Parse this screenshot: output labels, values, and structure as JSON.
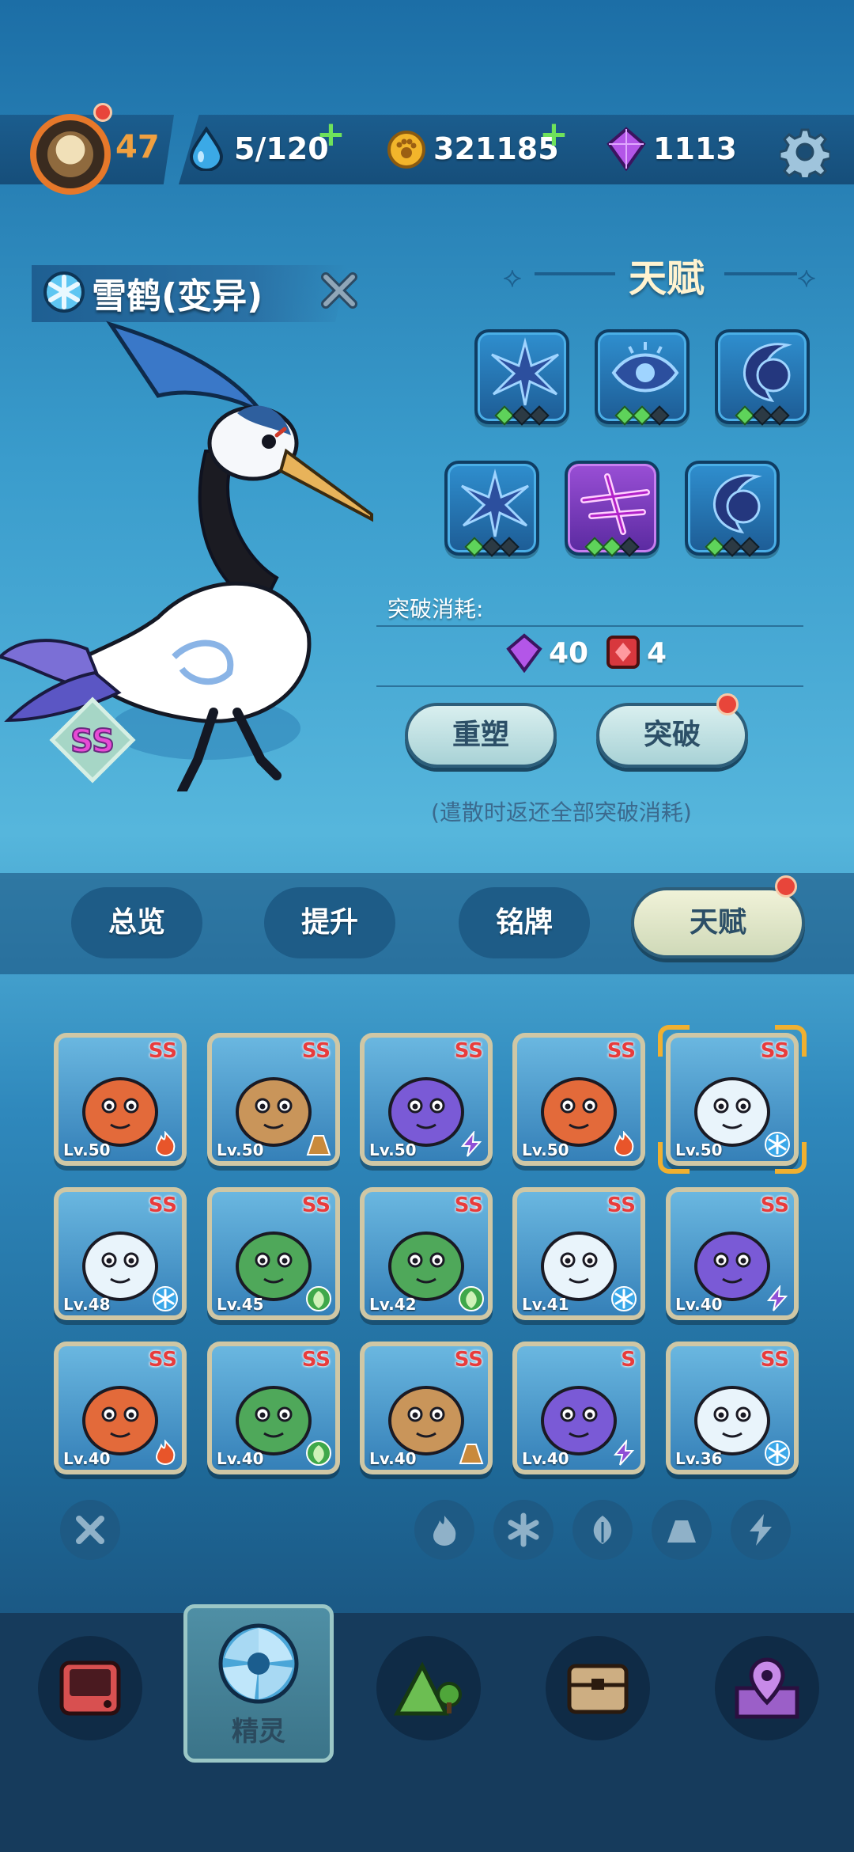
{
  "player": {
    "level": "47"
  },
  "resources": {
    "stamina": "5/120",
    "coins": "321185",
    "gems": "1113"
  },
  "pet": {
    "name": "雪鹤(变异)",
    "rank": "SS",
    "element": "ice"
  },
  "talent": {
    "title": "天赋",
    "slots": [
      {
        "icon": "ice-star-icon",
        "gems_lit": 1,
        "color": "blue"
      },
      {
        "icon": "eye-icon",
        "gems_lit": 2,
        "color": "blue"
      },
      {
        "icon": "crescent-icon",
        "gems_lit": 1,
        "color": "blue"
      },
      {
        "icon": "ice-star-icon",
        "gems_lit": 1,
        "color": "blue"
      },
      {
        "icon": "slash-star-icon",
        "gems_lit": 2,
        "color": "purple"
      },
      {
        "icon": "crescent-icon",
        "gems_lit": 1,
        "color": "blue"
      }
    ],
    "breakthrough_cost_label": "突破消耗:",
    "cost_gems": "40",
    "cost_items": "4",
    "reshape_label": "重塑",
    "breakthrough_label": "突破",
    "note": "(遣散时返还全部突破消耗)"
  },
  "tabs": [
    {
      "label": "总览"
    },
    {
      "label": "提升"
    },
    {
      "label": "铭牌"
    },
    {
      "label": "天赋",
      "active": true
    }
  ],
  "pets": [
    {
      "name": "fire-sprite",
      "rank": "SS",
      "level": "Lv.50",
      "element": "fire"
    },
    {
      "name": "mandrake",
      "rank": "SS",
      "level": "Lv.50",
      "element": "earth"
    },
    {
      "name": "purple-dragon",
      "rank": "SS",
      "level": "Lv.50",
      "element": "thunder"
    },
    {
      "name": "red-horn",
      "rank": "SS",
      "level": "Lv.50",
      "element": "fire"
    },
    {
      "name": "snow-crane",
      "rank": "SS",
      "level": "Lv.50",
      "element": "ice",
      "selected": true
    },
    {
      "name": "ice-fox",
      "rank": "SS",
      "level": "Lv.48",
      "element": "ice"
    },
    {
      "name": "green-serpent",
      "rank": "SS",
      "level": "Lv.45",
      "element": "grass"
    },
    {
      "name": "hooded-shade",
      "rank": "SS",
      "level": "Lv.42",
      "element": "grass"
    },
    {
      "name": "blue-dragon",
      "rank": "SS",
      "level": "Lv.41",
      "element": "ice"
    },
    {
      "name": "purple-pig",
      "rank": "SS",
      "level": "Lv.40",
      "element": "thunder"
    },
    {
      "name": "red-dragon",
      "rank": "SS",
      "level": "Lv.40",
      "element": "fire"
    },
    {
      "name": "leaf-monkey",
      "rank": "SS",
      "level": "Lv.40",
      "element": "grass"
    },
    {
      "name": "shiba",
      "rank": "SS",
      "level": "Lv.40",
      "element": "earth"
    },
    {
      "name": "purple-dragon-2",
      "rank": "S",
      "level": "Lv.40",
      "element": "thunder"
    },
    {
      "name": "snow-crane-2",
      "rank": "SS",
      "level": "Lv.36",
      "element": "ice"
    }
  ],
  "filters": [
    "fire-icon",
    "snowflake-icon",
    "leaf-icon",
    "mountain-icon",
    "lightning-icon"
  ],
  "nav": {
    "items": [
      "device-icon",
      "spirit-icon",
      "mountain-tree-icon",
      "chest-icon",
      "map-pin-icon"
    ],
    "active_label": "精灵"
  },
  "colors": {
    "fire": "#e8552a",
    "ice": "#3aa7e8",
    "grass": "#3fa84a",
    "earth": "#c98a3c",
    "thunder": "#8f4fd6"
  }
}
